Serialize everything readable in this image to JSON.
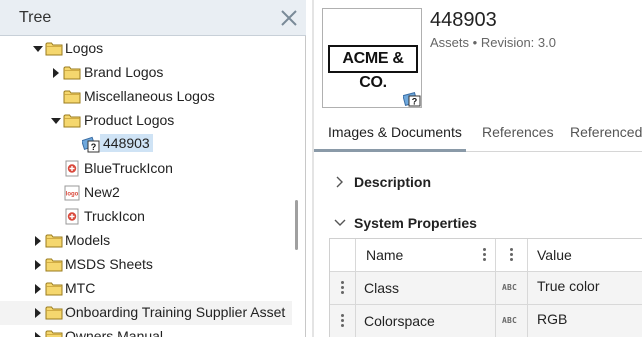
{
  "tree": {
    "title": "Tree",
    "items": [
      {
        "label": "Logos",
        "level": 1,
        "expanded": "expanded",
        "icon": "folder-icon"
      },
      {
        "label": "Brand Logos",
        "level": 2,
        "expanded": "collapsed",
        "icon": "folder-icon"
      },
      {
        "label": "Miscellaneous Logos",
        "level": 2,
        "expanded": "none",
        "icon": "folder-icon"
      },
      {
        "label": "Product Logos",
        "level": 2,
        "expanded": "expanded",
        "icon": "folder-icon"
      },
      {
        "label": "448903",
        "level": 3,
        "expanded": "none",
        "icon": "asset-icon",
        "selected": true
      },
      {
        "label": "BlueTruckIcon",
        "level": 2,
        "expanded": "none",
        "icon": "image-asset-icon"
      },
      {
        "label": "New2",
        "level": 2,
        "expanded": "none",
        "icon": "logo-asset-icon"
      },
      {
        "label": "TruckIcon",
        "level": 2,
        "expanded": "none",
        "icon": "image-asset-icon"
      },
      {
        "label": "Models",
        "level": 1,
        "expanded": "collapsed",
        "icon": "folder-icon"
      },
      {
        "label": "MSDS Sheets",
        "level": 1,
        "expanded": "collapsed",
        "icon": "folder-icon"
      },
      {
        "label": "MTC",
        "level": 1,
        "expanded": "collapsed",
        "icon": "folder-icon"
      },
      {
        "label": "Onboarding Training Supplier Asset",
        "level": 1,
        "expanded": "collapsed",
        "icon": "folder-icon"
      },
      {
        "label": "Owners Manual",
        "level": 1,
        "expanded": "collapsed",
        "icon": "folder-icon"
      }
    ]
  },
  "asset": {
    "id": "448903",
    "thumbnail_text": "ACME & CO.",
    "category": "Assets",
    "separator": "•",
    "revision": "Revision: 3.0"
  },
  "tabs": [
    {
      "label": "Images & Documents",
      "active": true
    },
    {
      "label": "References",
      "active": false
    },
    {
      "label": "Referenced",
      "active": false
    }
  ],
  "sections": {
    "description": "Description",
    "system_properties": "System Properties"
  },
  "properties_table": {
    "columns": [
      "Name",
      "Value"
    ],
    "type_badge": "ABC",
    "rows": [
      {
        "name": "Class",
        "value": "True color"
      },
      {
        "name": "Colorspace",
        "value": "RGB"
      }
    ]
  },
  "colors": {
    "header_bg": "#e9eef3",
    "folder_fill": "#f5d76e",
    "selection_bg": "#cfe3f5",
    "image_icon_red": "#d94a3d"
  }
}
